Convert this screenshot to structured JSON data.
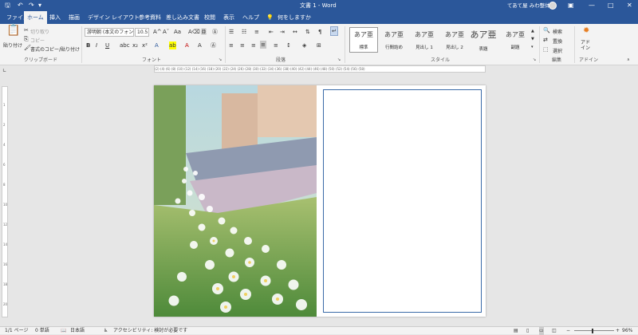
{
  "titlebar": {
    "undo_icon": "undo-icon",
    "redo_icon": "redo-icon",
    "save_icon": "save-icon",
    "doc_title": "文書 1  -  Word",
    "user_name": "てあて屋 みわ整体",
    "minimize": "—",
    "restore": "□",
    "close": "✕"
  },
  "tabs": [
    "ファイル",
    "ホーム",
    "挿入",
    "描画",
    "デザイン",
    "レイアウト",
    "参考資料",
    "差し込み文書",
    "校閲",
    "表示",
    "ヘルプ",
    "何をしますか"
  ],
  "active_tab": "ホーム",
  "ribbon": {
    "clipboard": {
      "paste": "貼り付け",
      "cut": "切り取り",
      "copy": "コピー",
      "format_painter": "書式のコピー/貼り付け",
      "label": "クリップボード"
    },
    "font": {
      "font_name": "游明朝 (本文のフォン",
      "font_size": "10.5",
      "label": "フォント"
    },
    "paragraph": {
      "label": "段落"
    },
    "styles": {
      "items": [
        {
          "glyph": "あア亜",
          "name": "標準"
        },
        {
          "glyph": "あア亜",
          "name": "行間詰め"
        },
        {
          "glyph": "あア亜",
          "name": "見出し 1"
        },
        {
          "glyph": "あア亜",
          "name": "見出し 2"
        },
        {
          "glyph": "あア亜",
          "name": "表題"
        },
        {
          "glyph": "あア亜",
          "name": "副題"
        }
      ],
      "label": "スタイル"
    },
    "editing": {
      "find": "検索",
      "replace": "置換",
      "select": "選択",
      "label": "編集"
    },
    "addin": {
      "name": "アド\nイン",
      "label": "アドイン"
    }
  },
  "ruler": {
    "h_marks": "(2) (4) (6) (8) (10) (12) (14) (16) (18) (20) (22) (24) (26) (28) (30) (32) (34) (36) (38) (40) (42) (44) (46) (48) (50) (52) (54) (56) (58)"
  },
  "statusbar": {
    "page": "1/1 ページ",
    "words": "0 単語",
    "language": "日本語",
    "accessibility": "アクセシビリティ: 検討が必要です",
    "zoom": "96%"
  }
}
